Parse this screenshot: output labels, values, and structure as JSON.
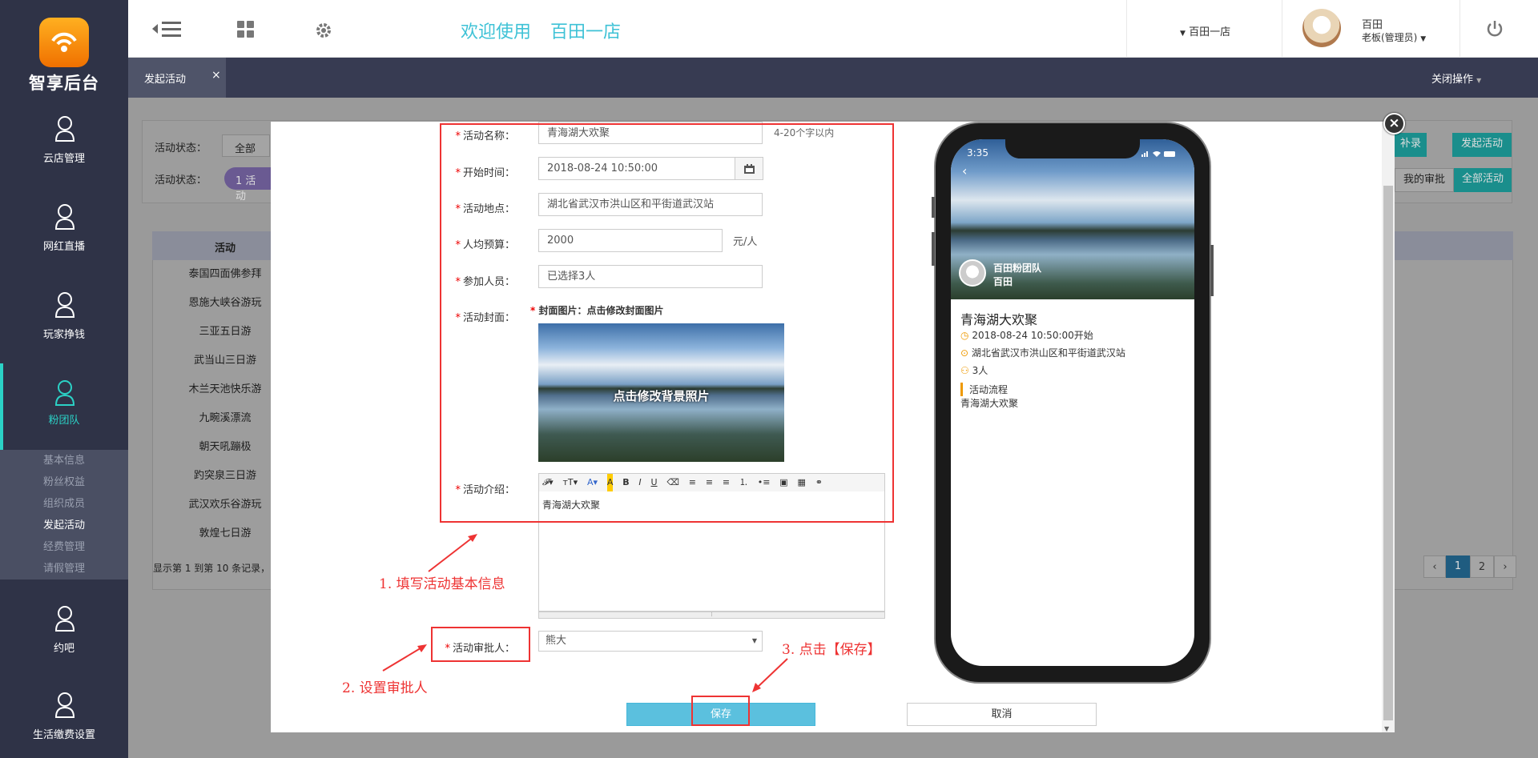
{
  "sidebar": {
    "logo_text": "智享后台",
    "items": [
      {
        "label": "云店管理"
      },
      {
        "label": "网红直播"
      },
      {
        "label": "玩家挣钱"
      },
      {
        "label": "粉团队"
      },
      {
        "label": "约吧"
      },
      {
        "label": "生活缴费设置"
      }
    ],
    "submenu": [
      "基本信息",
      "粉丝权益",
      "组织成员",
      "发起活动",
      "经费管理",
      "请假管理"
    ]
  },
  "topbar": {
    "welcome": "欢迎使用",
    "store_name": "百田一店",
    "store_select": "百田一店",
    "user_name": "百田",
    "user_role": "老板(管理员)"
  },
  "tabs": {
    "active_tab": "发起活动",
    "close_tab": "×",
    "close_ops": "关闭操作"
  },
  "background": {
    "filter_label_1": "活动状态：",
    "filter_value_1": "全部",
    "filter_label_2": "活动状态：",
    "filter_chip": "1 活动",
    "btn_record": "补录",
    "btn_launch": "发起活动",
    "btn_my_approval": "我的审批",
    "btn_all": "全部活动",
    "table_header": "活动",
    "rows": [
      "泰国四面佛参拜",
      "恩施大峡谷游玩",
      "三亚五日游",
      "武当山三日游",
      "木兰天池快乐游",
      "九畹溪漂流",
      "朝天吼蹦极",
      "趵突泉三日游",
      "武汉欢乐谷游玩",
      "敦煌七日游"
    ],
    "footer": "显示第 1 到第 10 条记录，",
    "pager": [
      "‹",
      "1",
      "2",
      "›"
    ]
  },
  "form": {
    "name_label": "活动名称：",
    "name_value": "青海湖大欢聚",
    "name_hint": "4-20个字以内",
    "time_label": "开始时间：",
    "time_value": "2018-08-24 10:50:00",
    "place_label": "活动地点：",
    "place_value": "湖北省武汉市洪山区和平街道武汉站",
    "budget_label": "人均预算：",
    "budget_value": "2000",
    "budget_unit": "元/人",
    "members_label": "参加人员：",
    "members_value": "已选择3人",
    "cover_label": "活动封面：",
    "cover_hint": "封面图片：点击修改封面图片",
    "cover_overlay": "点击修改背景照片",
    "intro_label": "活动介绍：",
    "intro_value": "青海湖大欢聚",
    "approver_label": "活动审批人：",
    "approver_value": "熊大",
    "save": "保存",
    "cancel": "取消"
  },
  "annotations": {
    "step1": "1. 填写活动基本信息",
    "step2": "2. 设置审批人",
    "step3": "3. 点击【保存】"
  },
  "phone": {
    "time": "3:35",
    "team": "百田粉团队",
    "owner": "百田",
    "title": "青海湖大欢聚",
    "start": "2018-08-24 10:50:00开始",
    "location": "湖北省武汉市洪山区和平街道武汉站",
    "people": "3人",
    "flow_title": "活动流程",
    "flow_text": "青海湖大欢聚"
  },
  "colors": {
    "accent": "#3ec2d6",
    "sidebar": "#2f3347",
    "teal": "#2bd2c6",
    "annotation": "#e33333"
  }
}
